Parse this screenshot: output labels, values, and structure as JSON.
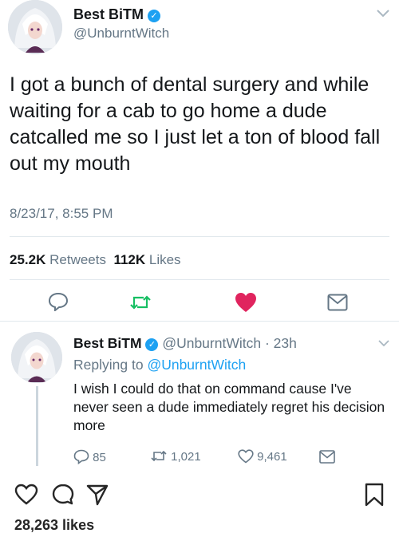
{
  "tweet": {
    "display_name": "Best BiTM",
    "handle": "@UnburntWitch",
    "text": "I got a bunch of dental surgery and while waiting for a cab to go home a dude catcalled me so I just let a ton of blood fall out my mouth",
    "timestamp": "8/23/17, 8:55 PM",
    "retweets_count": "25.2K",
    "retweets_label": "Retweets",
    "likes_count": "112K",
    "likes_label": "Likes"
  },
  "reply": {
    "display_name": "Best BiTM",
    "handle": "@UnburntWitch",
    "age": "23h",
    "replying_prefix": "Replying to",
    "replying_handle": "@UnburntWitch",
    "text": "I wish I could do that on command cause I've never seen a dude immediately regret his decision more",
    "reply_count": "85",
    "retweet_count": "1,021",
    "like_count": "9,461"
  },
  "instagram": {
    "likes": "28,263 likes"
  },
  "colors": {
    "twitter_blue": "#1da1f2",
    "like_red": "#e0245e",
    "retweet_green": "#17bf63",
    "muted": "#657786"
  },
  "icons": [
    "reply-icon",
    "retweet-icon",
    "heart-icon",
    "mail-icon",
    "chevron-down-icon",
    "verified-icon",
    "comment-icon",
    "send-icon",
    "bookmark-icon"
  ]
}
